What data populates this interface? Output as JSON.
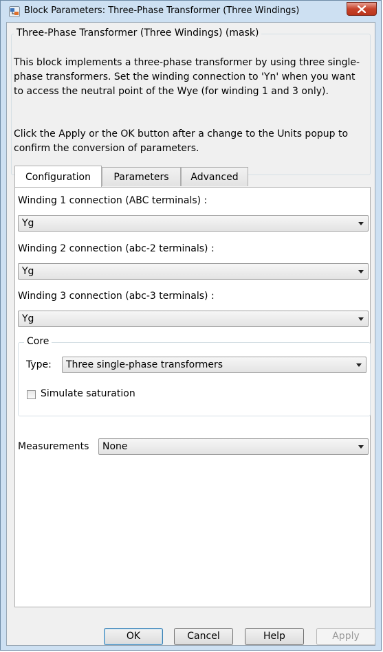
{
  "window": {
    "title": "Block Parameters: Three-Phase Transformer (Three Windings)"
  },
  "mask": {
    "legend": "Three-Phase Transformer (Three Windings) (mask)",
    "description": "This block implements a three-phase transformer by using three single-phase transformers. Set the winding connection to 'Yn' when you want to access the neutral point of the Wye (for winding 1 and 3 only).",
    "note": "Click the Apply or the OK button after a change to the Units popup to confirm the conversion of parameters."
  },
  "tabs": [
    {
      "label": "Configuration",
      "active": true
    },
    {
      "label": "Parameters",
      "active": false
    },
    {
      "label": "Advanced",
      "active": false
    }
  ],
  "configuration": {
    "winding1": {
      "label": "Winding 1 connection (ABC terminals)  :",
      "value": "Yg"
    },
    "winding2": {
      "label": "Winding 2 connection (abc-2 terminals) :",
      "value": "Yg"
    },
    "winding3": {
      "label": "Winding 3 connection (abc-3 terminals) :",
      "value": "Yg"
    },
    "core": {
      "legend": "Core",
      "type_label": "Type:",
      "type_value": "Three single-phase transformers",
      "saturation_label": "Simulate saturation",
      "saturation_checked": false
    },
    "measurements": {
      "label": "Measurements",
      "value": "None"
    }
  },
  "buttons": {
    "ok": "OK",
    "cancel": "Cancel",
    "help": "Help",
    "apply": "Apply"
  },
  "colors": {
    "frame": "#cde0f2",
    "client": "#f0f0f0",
    "close": "#c7432a"
  }
}
